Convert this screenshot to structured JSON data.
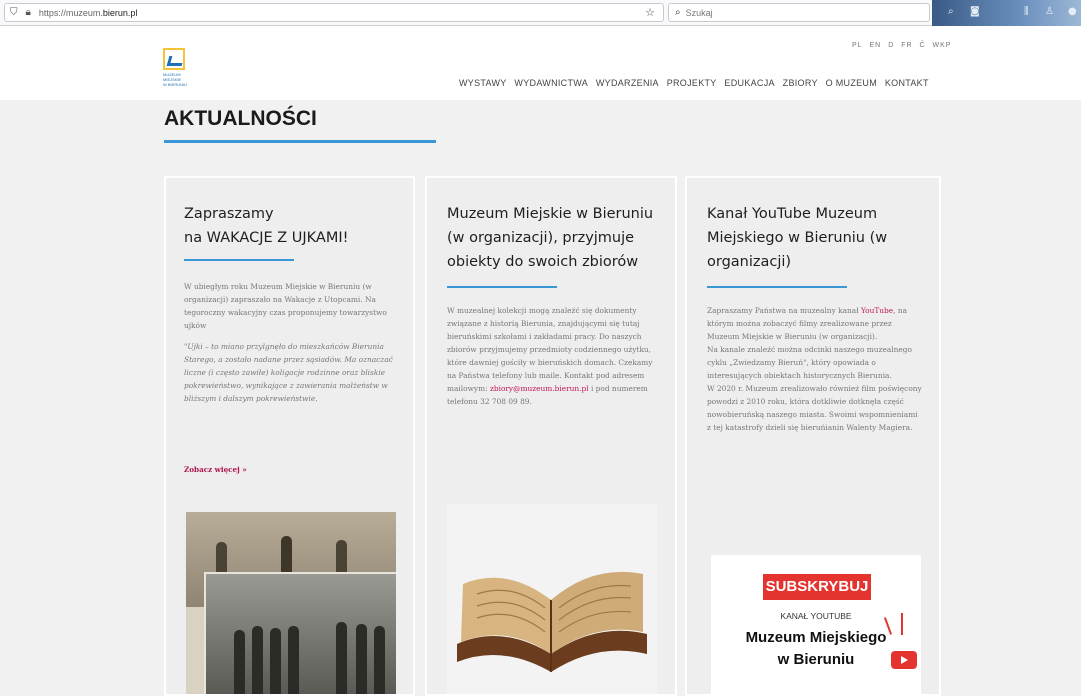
{
  "browser": {
    "url_prefix": "https://muzeum.",
    "url_domain": "bierun.pl",
    "search_placeholder": "Szukaj"
  },
  "header": {
    "logo_text": [
      "MUZEUM",
      "MIEJSKIE",
      "W BIERUNIU"
    ],
    "languages": [
      "PL",
      "EN",
      "D",
      "FR",
      "Č",
      "WKP"
    ],
    "nav": [
      "WYSTAWY",
      "WYDAWNICTWA",
      "WYDARZENIA",
      "PROJEKTY",
      "EDUKACJA",
      "ZBIORY",
      "O MUZEUM",
      "KONTAKT"
    ]
  },
  "page": {
    "title": "AKTUALNOŚCI",
    "accent_color": "#3a97d6"
  },
  "cards": [
    {
      "title": "Zapraszamy\nna WAKACJE Z UJKAMI!",
      "body": "W ubiegłym roku Muzeum Miejskie w Bieruniu (w organizacji) zapraszało na Wakacje z Utopcami. Na tegoroczny wakacyjny czas proponujemy towarzystwo ujków",
      "quote": "\"Ujki – to miano przylgnęło do mieszkańców Bierunia Starego, a zostało nadane przez sąsiadów. Ma oznaczać liczne (i często zawiłe) koligacje rodzinne oraz bliskie pokrewieństwo, wynikające z zawierania małżeństw w bliższym i dalszym pokrewieństwie.",
      "more": "Zobacz więcej »"
    },
    {
      "title": "Muzeum Miejskie w Bieruniu\n(w organizacji), przyjmuje\nobiekty do swoich zbiorów",
      "body": "W muzealnej kolekcji mogą znaleźć się dokumenty związane z historią Bierunia, znajdującymi się tutaj bieruńskimi szkołami i zakładami pracy. Do naszych zbiorów przyjmujemy przedmioty codziennego użytku, które dawniej gościły w bieruńskich domach. Czekamy na Państwa telefony lub maile. Kontakt pod adresem mailowym:",
      "email": "zbiory@muzeum.bierun.pl",
      "phone_text": " i pod numerem telefonu 32 708 09 89."
    },
    {
      "title": "Kanał YouTube Muzeum\nMiejskiego w Bieruniu (w\norganizacji)",
      "body_pre": "Zapraszamy Państwa na muzealny kanał ",
      "youtube_link": "YouTube",
      "body_post": ", na którym można zobaczyć filmy zrealizowane przez Muzeum Miejskie w Bieruniu (w organizacji).",
      "body2": "Na kanale znaleźć można odcinki naszego muzealnego cyklu „Zwiedzamy Bieruń\", który opowiada o interesujących obiektach historycznych Bierunia.",
      "body3": "W 2020 r. Muzeum zrealizowało również film poświęcony powodzi z 2010 roku, która dotkliwie dotknęła część nowobieruńską naszego miasta. Swoimi wspomnieniami z tej katastrofy dzieli się bieruńianin Walenty Magiera.",
      "promo": {
        "subscribe": "SUBSKRYBUJ",
        "kanal": "KANAŁ YOUTUBE",
        "name": "Muzeum Miejskiego\nw Bieruniu"
      }
    }
  ]
}
